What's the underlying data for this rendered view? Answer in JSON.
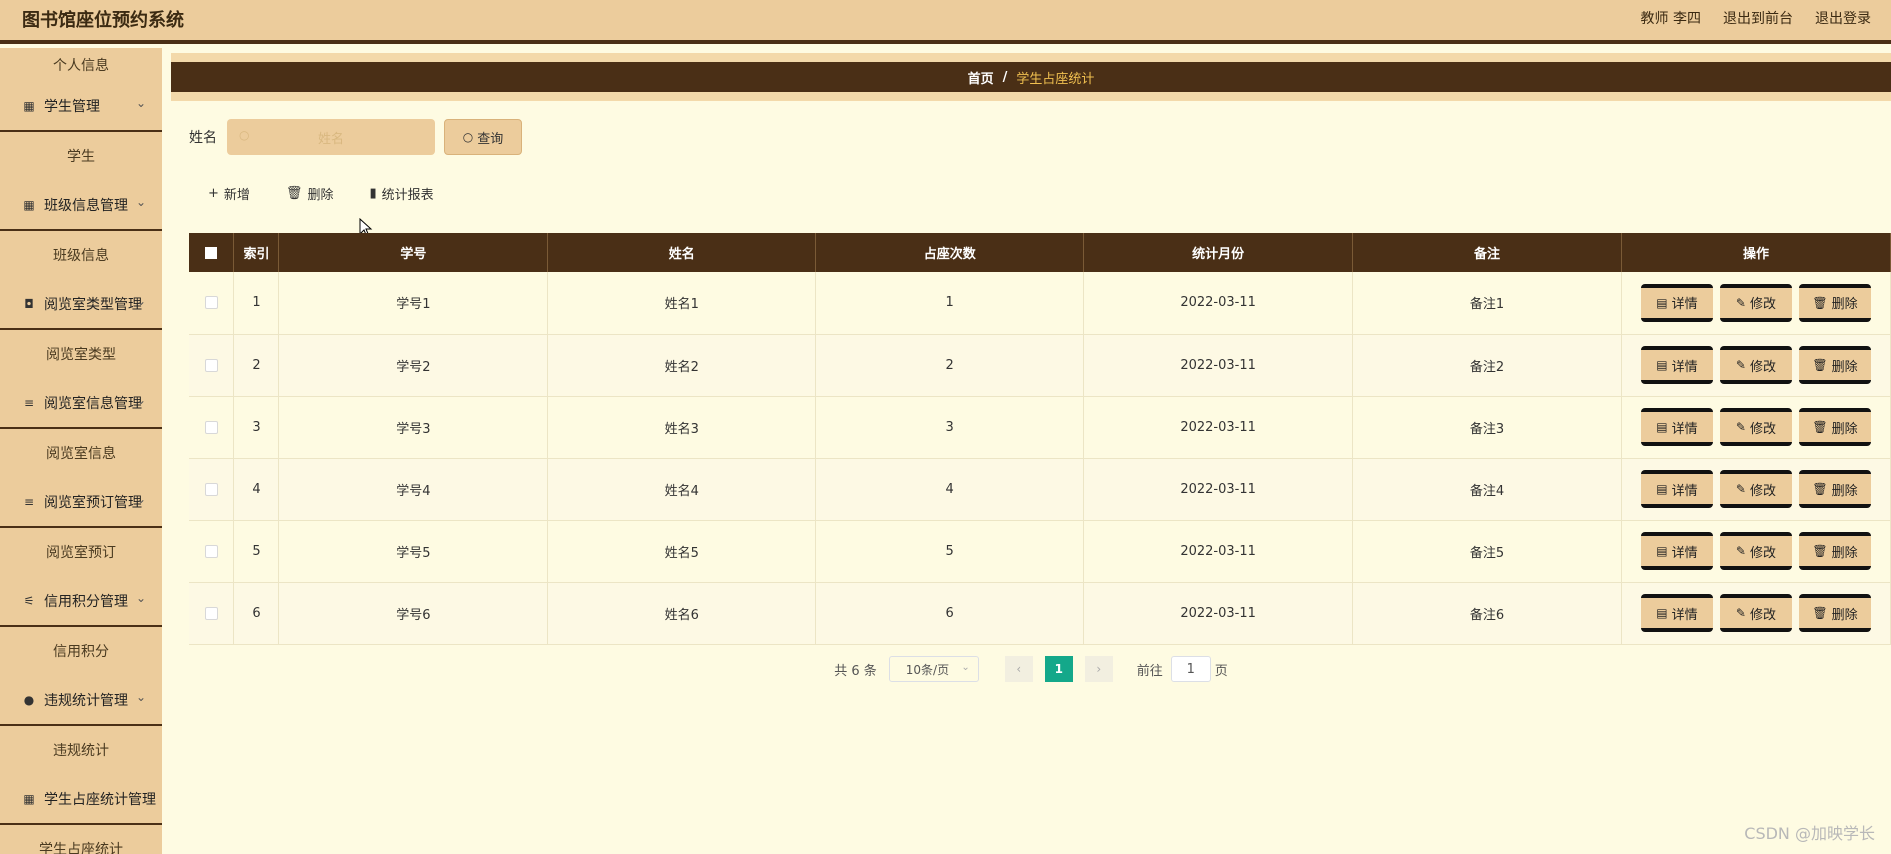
{
  "header": {
    "title": "图书馆座位预约系统",
    "user": "教师 李四",
    "link_front": "退出到前台",
    "link_logout": "退出登录"
  },
  "sidebar": {
    "top_item": "个人信息",
    "menus": [
      {
        "label": "学生管理",
        "icon": "grid-icon",
        "sub": "学生"
      },
      {
        "label": "班级信息管理",
        "icon": "grid-icon",
        "sub": "班级信息"
      },
      {
        "label": "阅览室类型管理",
        "icon": "briefcase-icon",
        "sub": "阅览室类型"
      },
      {
        "label": "阅览室信息管理",
        "icon": "list-icon",
        "sub": "阅览室信息"
      },
      {
        "label": "阅览室预订管理",
        "icon": "list-icon",
        "sub": "阅览室预订"
      },
      {
        "label": "信用积分管理",
        "icon": "sliders-icon",
        "sub": "信用积分"
      },
      {
        "label": "违规统计管理",
        "icon": "pin-icon",
        "sub": "违规统计"
      },
      {
        "label": "学生占座统计管理",
        "icon": "grid-icon",
        "sub": "学生占座统计"
      }
    ]
  },
  "breadcrumb": {
    "home": "首页",
    "separator": "/",
    "current": "学生占座统计"
  },
  "search": {
    "label": "姓名",
    "placeholder": "姓名",
    "button": "查询"
  },
  "actions": {
    "add": "新增",
    "delete": "删除",
    "report": "统计报表"
  },
  "table": {
    "headers": [
      "索引",
      "学号",
      "姓名",
      "占座次数",
      "统计月份",
      "备注",
      "操作"
    ],
    "rows": [
      {
        "index": "1",
        "xuehao": "学号1",
        "name": "姓名1",
        "count": "1",
        "month": "2022-03-11",
        "note": "备注1"
      },
      {
        "index": "2",
        "xuehao": "学号2",
        "name": "姓名2",
        "count": "2",
        "month": "2022-03-11",
        "note": "备注2"
      },
      {
        "index": "3",
        "xuehao": "学号3",
        "name": "姓名3",
        "count": "3",
        "month": "2022-03-11",
        "note": "备注3"
      },
      {
        "index": "4",
        "xuehao": "学号4",
        "name": "姓名4",
        "count": "4",
        "month": "2022-03-11",
        "note": "备注4"
      },
      {
        "index": "5",
        "xuehao": "学号5",
        "name": "姓名5",
        "count": "5",
        "month": "2022-03-11",
        "note": "备注5"
      },
      {
        "index": "6",
        "xuehao": "学号6",
        "name": "姓名6",
        "count": "6",
        "month": "2022-03-11",
        "note": "备注6"
      }
    ],
    "op_detail": "详情",
    "op_edit": "修改",
    "op_delete": "删除"
  },
  "pagination": {
    "total": "共 6 条",
    "page_size": "10条/页",
    "current_page": "1",
    "goto_label": "前往",
    "goto_value": "1",
    "page_unit": "页"
  },
  "watermark": "CSDN @加映学长",
  "colors": {
    "header_bg": "#eccc9c",
    "dark_brown": "#4a2f16",
    "page_bg": "#fefbe2",
    "breadcrumb_current": "#f0c050",
    "pager_active": "#14a88a"
  }
}
